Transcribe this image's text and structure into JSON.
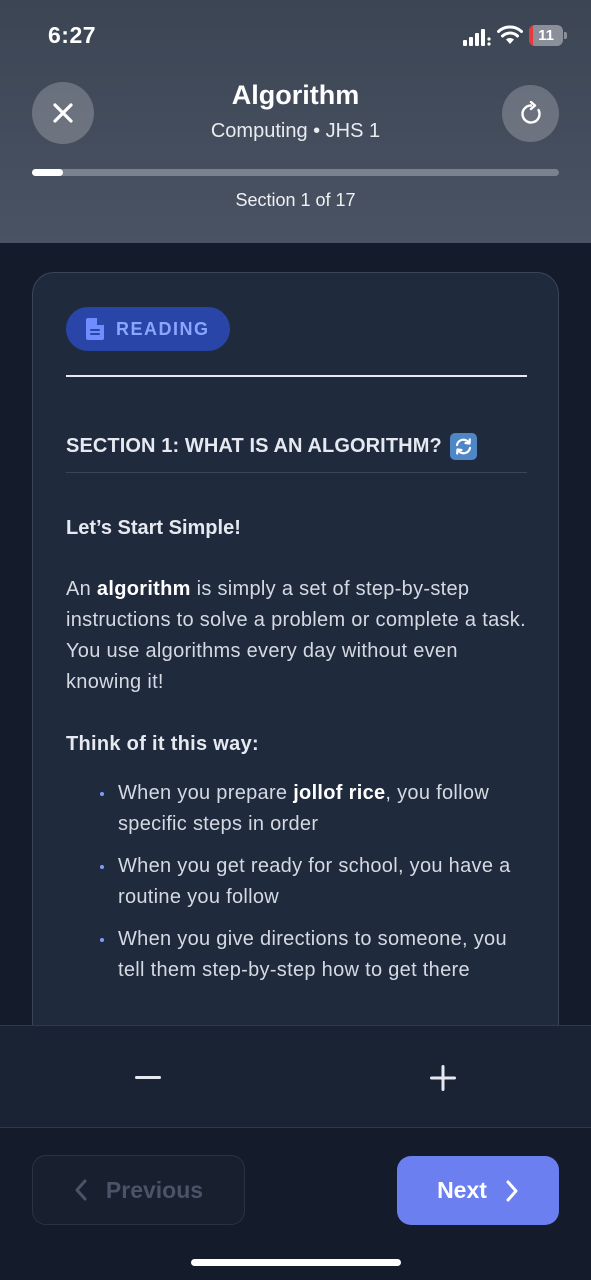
{
  "status_bar": {
    "time": "6:27",
    "battery_level": "11",
    "battery_fraction": 0.11,
    "battery_color": "#e5393b"
  },
  "header": {
    "title": "Algorithm",
    "subtitle": "Computing • JHS 1",
    "progress_fraction": 0.059,
    "section_label": "Section 1 of 17",
    "close_icon": "close-icon",
    "refresh_icon": "refresh-icon"
  },
  "card": {
    "badge_icon": "document-icon",
    "badge_label": "READING",
    "section_heading": "SECTION 1: WHAT IS AN ALGORITHM?",
    "section_heading_emoji": "sync-icon",
    "sub_heading": "Let’s Start Simple!",
    "intro_before": "An ",
    "intro_bold": "algorithm",
    "intro_after": " is simply a set of step-by-step instructions to solve a problem or complete a task. You use algorithms every day without even knowing it!",
    "think_heading": "Think of it this way:",
    "bullets": [
      {
        "before": "When you prepare ",
        "bold": "jollof rice",
        "after": ", you follow specific steps in order"
      },
      {
        "before": "When you get ready for school, you have a routine you follow",
        "bold": "",
        "after": ""
      },
      {
        "before": "When you give directions to someone, you tell them step-by-step how to get there",
        "bold": "",
        "after": ""
      }
    ]
  },
  "zoom": {
    "decrease_icon": "minus-icon",
    "increase_icon": "plus-icon"
  },
  "nav": {
    "previous_label": "Previous",
    "next_label": "Next"
  },
  "colors": {
    "accent": "#6b7ff0",
    "badge_bg": "#2a45a8",
    "badge_text": "#8ba6ff",
    "background": "#141c2c"
  }
}
